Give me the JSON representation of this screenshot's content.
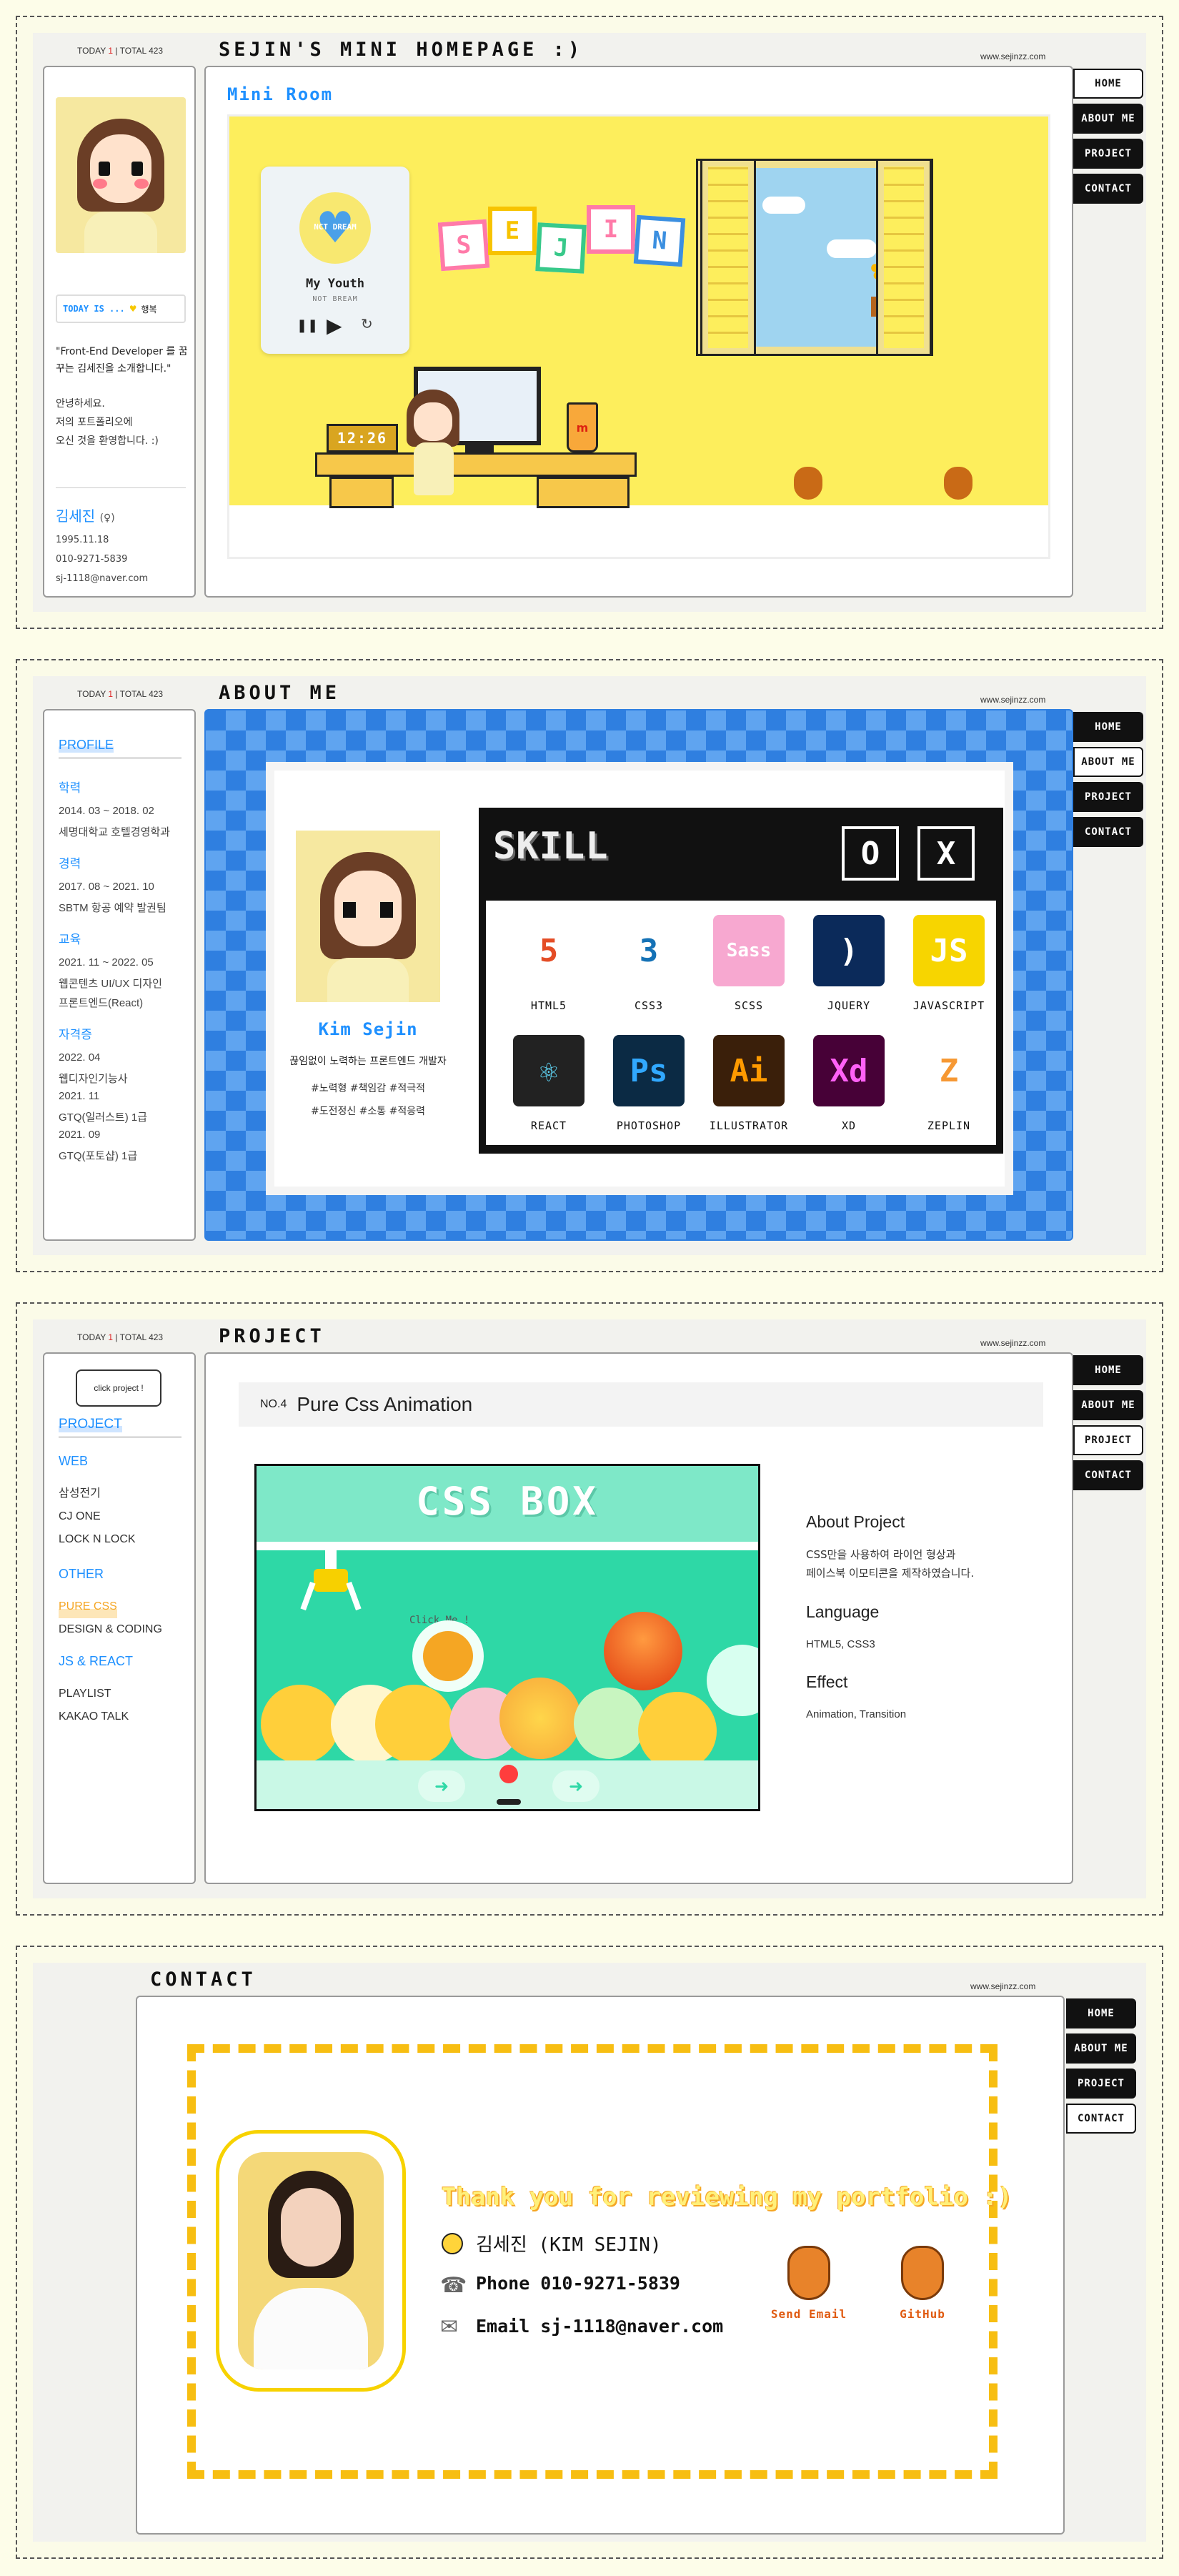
{
  "common": {
    "counter_today": "TODAY",
    "counter_today_num": "1",
    "counter_total": "TOTAL 423",
    "url": "www.sejinzz.com"
  },
  "nav": {
    "home": "HOME",
    "about": "ABOUT ME",
    "project": "PROJECT",
    "contact": "CONTACT"
  },
  "s1": {
    "title": "SEJIN'S MINI HOMEPAGE :)",
    "today_label": "TODAY IS ...",
    "today_mood": "행복",
    "quote": "\"Front-End Developer 를 꿈꾸는 김세진을 소개합니다.\"",
    "greeting1": "안녕하세요.",
    "greeting2": "저의 포트폴리오에",
    "greeting3": "오신 것을 환영합니다. :)",
    "name": "김세진",
    "name_suffix": "(♀)",
    "birth": "1995.11.18",
    "phone": "010-9271-5839",
    "email": "sj-1118@naver.com",
    "room_title": "Mini Room",
    "music_title": "My Youth",
    "music_artist": "NOT BREAM",
    "clock": "12:26",
    "blocks": [
      "S",
      "E",
      "J",
      "I",
      "N"
    ],
    "heart_text": "NCT DREAM"
  },
  "s2": {
    "title": "ABOUT ME",
    "profile_head": "PROFILE",
    "groups": [
      {
        "head": "학력",
        "lines": [
          "2014. 03 ~ 2018. 02",
          "세명대학교 호텔경영학과"
        ]
      },
      {
        "head": "경력",
        "lines": [
          "2017. 08 ~ 2021. 10",
          "SBTM 항공 예약 발권팀"
        ]
      },
      {
        "head": "교육",
        "lines": [
          "2021. 11 ~ 2022. 05",
          "웹콘텐츠 UI/UX 디자인",
          "프론트엔드(React)"
        ]
      },
      {
        "head": "자격증",
        "lines": [
          "2022. 04",
          "웹디자인기능사",
          "2021. 11",
          "GTQ(일러스트) 1급",
          "2021. 09",
          "GTQ(포토샵) 1급"
        ]
      }
    ],
    "card_name": "Kim Sejin",
    "card_desc": "끊임없이 노력하는 프론트엔드 개발자",
    "tags1": "#노력형 #책임감 #적극적",
    "tags2": "#도전정신 #소통 #적응력",
    "skill_title": "SKILL",
    "skill_btn1": "O",
    "skill_btn2": "X",
    "skills": [
      {
        "label": "HTML5",
        "glyph": "5",
        "bg": "#ffffff",
        "fg": "#e44d26"
      },
      {
        "label": "CSS3",
        "glyph": "3",
        "bg": "#ffffff",
        "fg": "#1572b6"
      },
      {
        "label": "SCSS",
        "glyph": "Sass",
        "bg": "#f7a8d0",
        "fg": "#ffffff"
      },
      {
        "label": "JQUERY",
        "glyph": ")",
        "bg": "#0b2a5a",
        "fg": "#ffffff"
      },
      {
        "label": "JAVASCRIPT",
        "glyph": "JS",
        "bg": "#f7d500",
        "fg": "#ffffff"
      },
      {
        "label": "REACT",
        "glyph": "⚛",
        "bg": "#222222",
        "fg": "#61dafb"
      },
      {
        "label": "PHOTOSHOP",
        "glyph": "Ps",
        "bg": "#0b2a44",
        "fg": "#31a8ff"
      },
      {
        "label": "ILLUSTRATOR",
        "glyph": "Ai",
        "bg": "#3a1f0a",
        "fg": "#ff9a00"
      },
      {
        "label": "XD",
        "glyph": "Xd",
        "bg": "#470137",
        "fg": "#ff61f6"
      },
      {
        "label": "ZEPLIN",
        "glyph": "Z",
        "bg": "#ffffff",
        "fg": "#f69833"
      }
    ]
  },
  "s3": {
    "title": "PROJECT",
    "bubble": "click project !",
    "head": "PROJECT",
    "cat_web": "WEB",
    "web_items": [
      "삼성전기",
      "CJ ONE",
      "LOCK N LOCK"
    ],
    "cat_other": "OTHER",
    "other_items": [
      "PURE CSS",
      "DESIGN & CODING"
    ],
    "cat_js": "JS & REACT",
    "js_items": [
      "PLAYLIST",
      "KAKAO TALK"
    ],
    "no": "NO.4",
    "project_title": "Pure Css Animation",
    "box_title": "CSS BOX",
    "click_me": "Click Me !",
    "about_head": "About Project",
    "about_1": "CSS만을 사용하여 라이언 형상과",
    "about_2": "페이스북 이모티콘을 제작하였습니다.",
    "lang_head": "Language",
    "lang_val": "HTML5, CSS3",
    "effect_head": "Effect",
    "effect_val": "Animation, Transition"
  },
  "s4": {
    "title": "CONTACT",
    "thanks": "Thank you for reviewing my portfolio :)",
    "name": "김세진 (KIM SEJIN)",
    "phone": "Phone 010-9271-5839",
    "email": "Email sj-1118@naver.com",
    "send_email": "Send Email",
    "github": "GitHub"
  },
  "colors": {
    "accent_blue": "#1e90ff",
    "yellow": "#fff07a",
    "orange": "#f5a623",
    "mint": "#34d9a8"
  }
}
